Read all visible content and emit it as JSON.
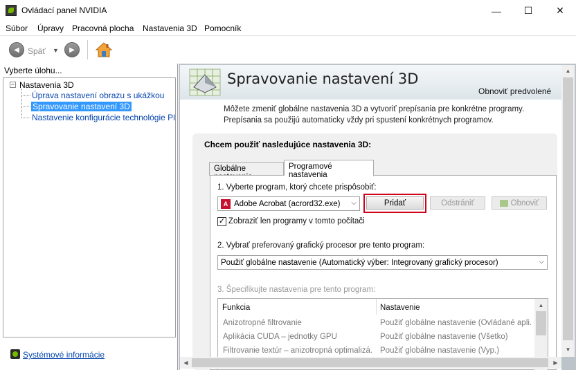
{
  "window": {
    "title": "Ovládací panel NVIDIA",
    "minimize": "—",
    "maximize": "☐",
    "close": "✕"
  },
  "menu": [
    "Súbor",
    "Úpravy",
    "Pracovná plocha",
    "Nastavenia 3D",
    "Pomocník"
  ],
  "toolbar": {
    "back_label": "Späť",
    "back_arrow": "◀",
    "forward_arrow": "▶",
    "dropdown_arrow": "▼"
  },
  "left": {
    "task_label": "Vyberte úlohu...",
    "tree_toggle": "−",
    "tree_root": "Nastavenia 3D",
    "tree_items": [
      "Úprava nastavení obrazu s ukážkou",
      "Spravovanie nastavení 3D",
      "Nastavenie konfigurácie technológie PhysX"
    ],
    "selected_index": 1,
    "sysinfo_link": "Systémové informácie"
  },
  "main": {
    "title": "Spravovanie nastavení 3D",
    "restore_link": "Obnoviť predvolené",
    "description": "Môžete zmeniť globálne nastavenia 3D a vytvoriť prepísania pre konkrétne programy. Prepísania sa použijú automaticky vždy pri spustení konkrétnych programov.",
    "settings_heading": "Chcem použiť nasledujúce nastavenia 3D:",
    "tabs": [
      "Globálne nastavenia",
      "Programové nastavenia"
    ],
    "active_tab": 1,
    "step1_label": "1. Vyberte program, ktorý chcete prispôsobiť:",
    "program_value": "Adobe Acrobat (acrord32.exe)",
    "pdf_glyph": "A",
    "chevron": "⌵",
    "add_button": "Pridať",
    "remove_button": "Odstrániť",
    "restore_button": "Obnoviť",
    "checkbox_label": "Zobraziť len programy v tomto počítači",
    "checkbox_mark": "✓",
    "step2_label": "2. Vybrať preferovaný grafický procesor pre tento program:",
    "gpu_value": "Použiť globálne nastavenie (Automatický výber: Integrovaný grafický procesor)",
    "step3_label": "3. Špecifikujte nastavenia pre tento program:",
    "grid": {
      "headers": [
        "Funkcia",
        "Nastavenie"
      ],
      "rows": [
        [
          "Anizotropné filtrovanie",
          "Použiť globálne nastavenie (Ovládané apli..."
        ],
        [
          "Aplikácia CUDA – jednotky GPU",
          "Použiť globálne nastavenie (Všetko)"
        ],
        [
          "Filtrovanie textúr – anizotropná optimalizá...",
          "Použiť globálne nastavenie (Vyp.)"
        ]
      ]
    },
    "scroll_up": "▲",
    "scroll_down": "▼",
    "scroll_left": "◀",
    "scroll_right": "▶"
  },
  "colors": {
    "nvidia_green": "#76b900",
    "highlight_red": "#d0021b",
    "selection_blue": "#3399ff",
    "link_blue": "#0645ad"
  }
}
